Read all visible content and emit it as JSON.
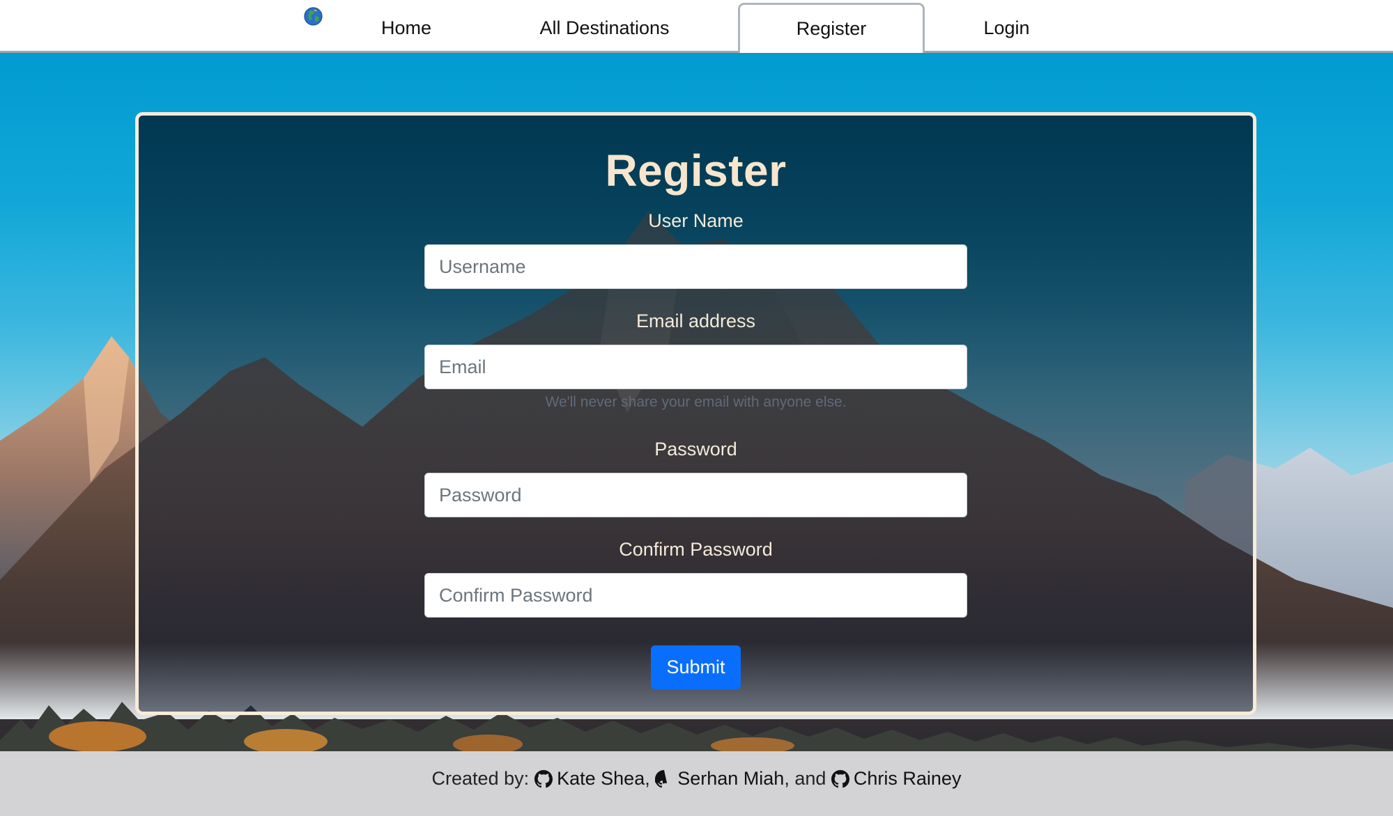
{
  "nav": {
    "logo_icon": "globe-icon",
    "links": [
      "Home",
      "All Destinations",
      "Register",
      "Login"
    ],
    "active": "Register"
  },
  "form": {
    "title": "Register",
    "username": {
      "label": "User Name",
      "placeholder": "Username"
    },
    "email": {
      "label": "Email address",
      "placeholder": "Email",
      "help": "We'll never share your email with anyone else."
    },
    "password": {
      "label": "Password",
      "placeholder": "Password"
    },
    "confirm": {
      "label": "Confirm Password",
      "placeholder": "Confirm Password"
    },
    "submit_label": "Submit"
  },
  "footer": {
    "prefix": "Created by:",
    "authors": [
      "Kate Shea",
      "Serhan Miah",
      "Chris Rainey"
    ],
    "sep1": ", ",
    "sep2": ", and ",
    "author_icon": "github-icon"
  },
  "colors": {
    "primary": "#0a6efd",
    "title": "#f7e6cd",
    "card_border": "#f7ebd9",
    "footer_bg": "#d3d3d5"
  }
}
